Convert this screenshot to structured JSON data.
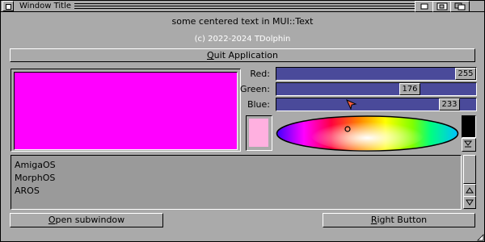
{
  "window": {
    "title": "Window Title"
  },
  "header": {
    "text": "some centered text in MUI::Text",
    "copyright": "(c) 2022-2024 TDolphin"
  },
  "buttons": {
    "quit": {
      "prefix": "",
      "mnemonic": "Q",
      "rest": "uit Application"
    },
    "open": {
      "prefix": "",
      "mnemonic": "O",
      "rest": "pen subwindow"
    },
    "right": {
      "prefix": "",
      "mnemonic": "R",
      "rest": "ight Button"
    }
  },
  "colors": {
    "swatch": "#ff00ff",
    "small_swatch": "#ffb0e0",
    "slider_track": "#4a4a9a",
    "window_bg": "#aaaaaa"
  },
  "rgb": {
    "red": {
      "label": "Red:",
      "value": "255"
    },
    "green": {
      "label": "Green:",
      "value": "176"
    },
    "blue": {
      "label": "Blue:",
      "value": "233"
    }
  },
  "list": {
    "items": [
      "AmigaOS",
      "MorphOS",
      "AROS"
    ]
  }
}
